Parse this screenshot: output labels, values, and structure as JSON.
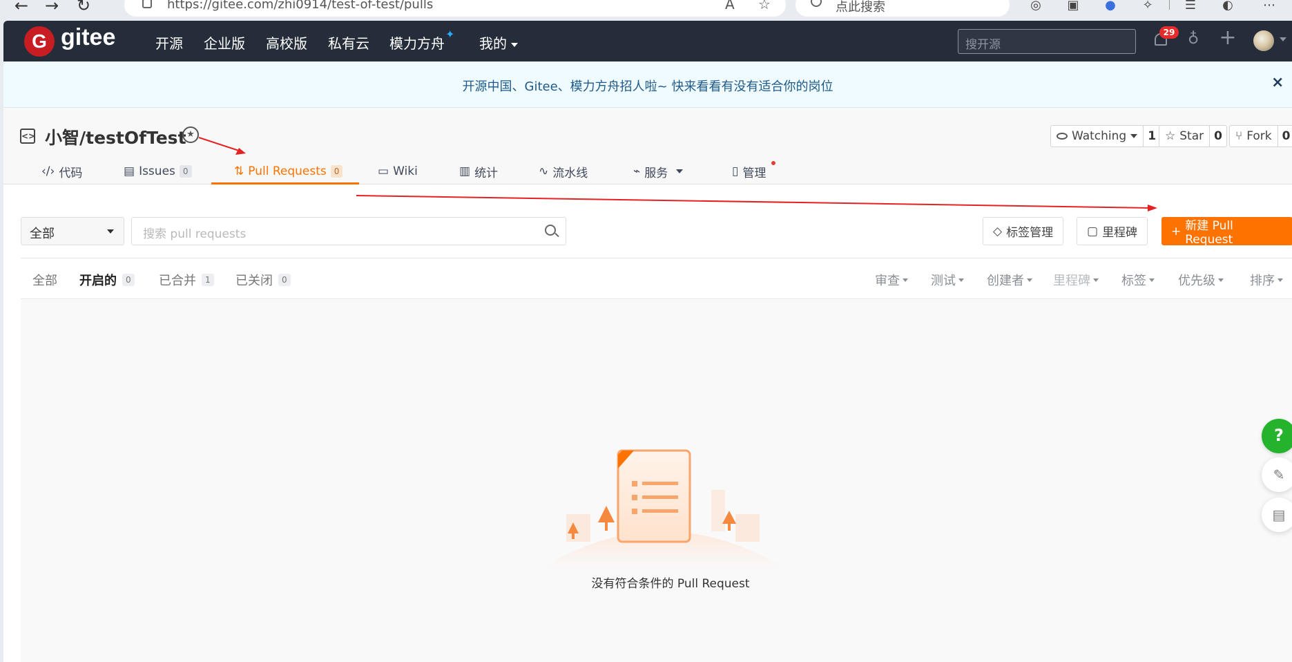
{
  "browser": {
    "url": "https://gitee.com/zhi0914/test-of-test/pulls",
    "search_placeholder": "点此搜索",
    "back_icon": "back-arrow-icon",
    "forward_icon": "forward-arrow-icon",
    "refresh_icon": "refresh-icon"
  },
  "header": {
    "logo_letter": "G",
    "logo_text": "gitee",
    "nav": [
      "开源",
      "企业版",
      "高校版",
      "私有云",
      "模力方舟",
      "我的"
    ],
    "search_placeholder": "搜开源",
    "notification_count": "29",
    "accent_color": "#c71d23",
    "bg_color": "#262d3a"
  },
  "banner": {
    "text": "开源中国、Gitee、模力方舟招人啦~ 快来看看有没有适合你的岗位",
    "close": "×"
  },
  "repo": {
    "title": "小智/testOfTest",
    "watch_label": "Watching",
    "watch_count": "1",
    "star_label": "Star",
    "star_count": "0",
    "fork_label": "Fork",
    "fork_count": "0"
  },
  "tabs": [
    {
      "label": "代码",
      "icon": "code-icon"
    },
    {
      "label": "Issues",
      "count": "0",
      "icon": "issues-icon"
    },
    {
      "label": "Pull Requests",
      "count": "0",
      "icon": "pull-request-icon",
      "active": true
    },
    {
      "label": "Wiki",
      "icon": "wiki-icon"
    },
    {
      "label": "统计",
      "icon": "stats-icon"
    },
    {
      "label": "流水线",
      "icon": "pipeline-icon"
    },
    {
      "label": "服务",
      "icon": "service-icon"
    },
    {
      "label": "管理",
      "icon": "manage-icon"
    }
  ],
  "toolbar": {
    "filter_value": "全部",
    "search_placeholder": "搜索 pull requests",
    "labels_button": "标签管理",
    "milestones_button": "里程碑",
    "new_pr_button": "新建 Pull Request",
    "primary_color": "#fe7300"
  },
  "filters": {
    "states": [
      {
        "label": "全部"
      },
      {
        "label": "开启的",
        "count": "0",
        "active": true
      },
      {
        "label": "已合并",
        "count": "1"
      },
      {
        "label": "已关闭",
        "count": "0"
      }
    ],
    "sorts": [
      "审查",
      "测试",
      "创建者",
      "里程碑",
      "标签",
      "优先级",
      "排序"
    ]
  },
  "empty": {
    "message": "没有符合条件的 Pull Request"
  },
  "floating": {
    "help": "?",
    "edit_icon": "edit-icon",
    "chat_icon": "chat-icon"
  }
}
